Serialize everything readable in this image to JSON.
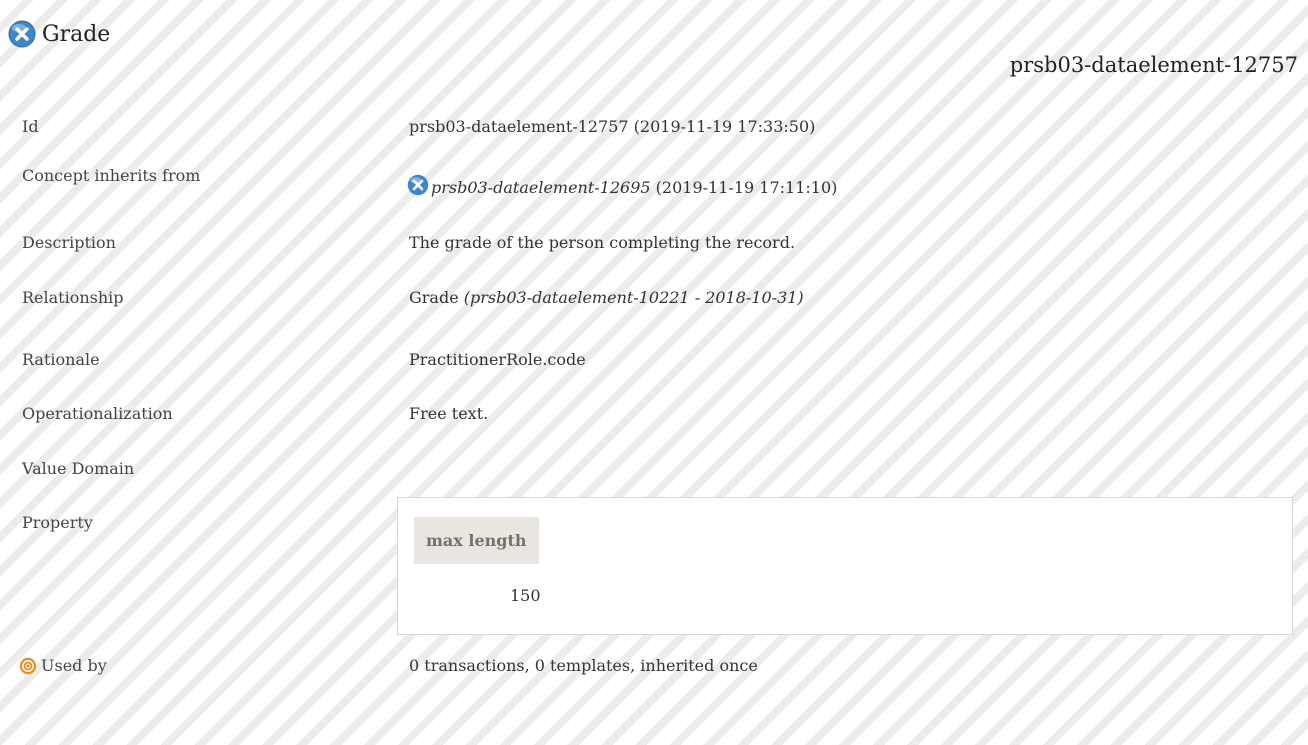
{
  "header": {
    "icon": "dataelement-icon",
    "title": "Grade",
    "subtitle": "prsb03-dataelement-12757"
  },
  "colors": {
    "icon_blue": "#3f86c9",
    "target_orange": "#f08a18",
    "property_header_bg": "#e9e6e1",
    "property_header_text": "#7a6f65"
  },
  "rows": {
    "id": {
      "label": "Id",
      "value": "prsb03-dataelement-12757 (2019-11-19 17:33:50)"
    },
    "inherits": {
      "label": "Concept inherits from",
      "link": "prsb03-dataelement-12695",
      "date": " (2019-11-19 17:11:10)"
    },
    "description": {
      "label": "Description",
      "value": "The grade of the person completing the record."
    },
    "relationship": {
      "label": "Relationship",
      "value": "Grade ",
      "ref": "(prsb03-dataelement-10221 - 2018-10-31)"
    },
    "rationale": {
      "label": "Rationale",
      "value": "PractitionerRole.code"
    },
    "operationalization": {
      "label": "Operationalization",
      "value": "Free text."
    },
    "value_domain": {
      "label": "Value Domain"
    },
    "property": {
      "label": "Property",
      "column_header": "max length",
      "value": "150"
    },
    "used_by": {
      "label": "Used by",
      "icon": "target-icon",
      "value": "0 transactions, 0 templates, inherited once"
    }
  }
}
